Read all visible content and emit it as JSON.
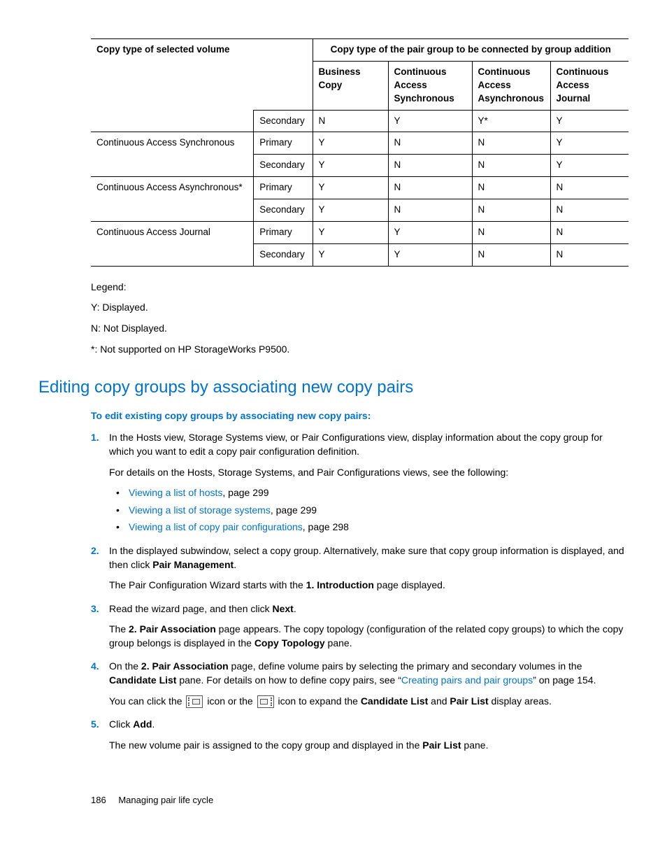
{
  "table": {
    "header_top_left": "Copy type of selected volume",
    "header_top_right": "Copy type of the pair group to be connected by group addition",
    "cols": {
      "c1": "Business Copy",
      "c2": "Continuous Access Synchronous",
      "c3": "Continuous Access Asynchronous",
      "c4": "Continuous Access Journal"
    },
    "rows": [
      {
        "label": "",
        "sub": "Secondary",
        "v": [
          "N",
          "Y",
          "Y*",
          "Y"
        ]
      },
      {
        "label": "Continuous Access Synchronous",
        "sub": "Primary",
        "v": [
          "Y",
          "N",
          "N",
          "Y"
        ]
      },
      {
        "label": "",
        "sub": "Secondary",
        "v": [
          "Y",
          "N",
          "N",
          "Y"
        ]
      },
      {
        "label": "Continuous Access Asynchronous*",
        "sub": "Primary",
        "v": [
          "Y",
          "N",
          "N",
          "N"
        ]
      },
      {
        "label": "",
        "sub": "Secondary",
        "v": [
          "Y",
          "N",
          "N",
          "N"
        ]
      },
      {
        "label": "Continuous Access Journal",
        "sub": "Primary",
        "v": [
          "Y",
          "Y",
          "N",
          "N"
        ]
      },
      {
        "label": "",
        "sub": "Secondary",
        "v": [
          "Y",
          "Y",
          "N",
          "N"
        ]
      }
    ]
  },
  "legend": {
    "title": "Legend:",
    "y": "Y: Displayed.",
    "n": "N: Not Displayed.",
    "star": "*: Not supported on HP StorageWorks P9500."
  },
  "section_title": "Editing copy groups by associating new copy pairs",
  "subhead": "To edit existing copy groups by associating new copy pairs:",
  "steps": {
    "s1p1": "In the Hosts view, Storage Systems view, or Pair Configurations view, display information about the copy group for which you want to edit a copy pair configuration definition.",
    "s1p2": "For details on the Hosts, Storage Systems, and Pair Configurations views, see the following:",
    "s1b1a": "Viewing a list of hosts",
    "s1b1b": ", page 299",
    "s1b2a": "Viewing a list of storage systems",
    "s1b2b": ", page 299",
    "s1b3a": "Viewing a list of copy pair configurations",
    "s1b3b": ", page 298",
    "s2a": "In the displayed subwindow, select a copy group. Alternatively, make sure that copy group information is displayed, and then click ",
    "s2b": "Pair Management",
    "s2c": ".",
    "s2p2a": "The Pair Configuration Wizard starts with the ",
    "s2p2b": "1. Introduction",
    "s2p2c": " page displayed.",
    "s3a": "Read the wizard page, and then click ",
    "s3b": "Next",
    "s3c": ".",
    "s3p2a": "The ",
    "s3p2b": "2. Pair Association",
    "s3p2c": " page appears. The copy topology (configuration of the related copy groups) to which the copy group belongs is displayed in the ",
    "s3p2d": "Copy Topology",
    "s3p2e": " pane.",
    "s4a": "On the ",
    "s4b": "2. Pair Association",
    "s4c": " page, define volume pairs by selecting the primary and secondary volumes in the ",
    "s4d": "Candidate List",
    "s4e": " pane. For details on how to define copy pairs, see “",
    "s4link": "Creating pairs and pair groups",
    "s4f": "” on page 154.",
    "s4p2a": "You can click the ",
    "s4p2b": " icon or the ",
    "s4p2c": " icon to expand the ",
    "s4p2d": "Candidate List",
    "s4p2e": " and ",
    "s4p2f": "Pair List",
    "s4p2g": " display areas.",
    "s5a": "Click ",
    "s5b": "Add",
    "s5c": ".",
    "s5p2a": "The new volume pair is assigned to the copy group and displayed in the ",
    "s5p2b": "Pair List",
    "s5p2c": " pane."
  },
  "footer": {
    "page": "186",
    "chapter": "Managing pair life cycle"
  }
}
